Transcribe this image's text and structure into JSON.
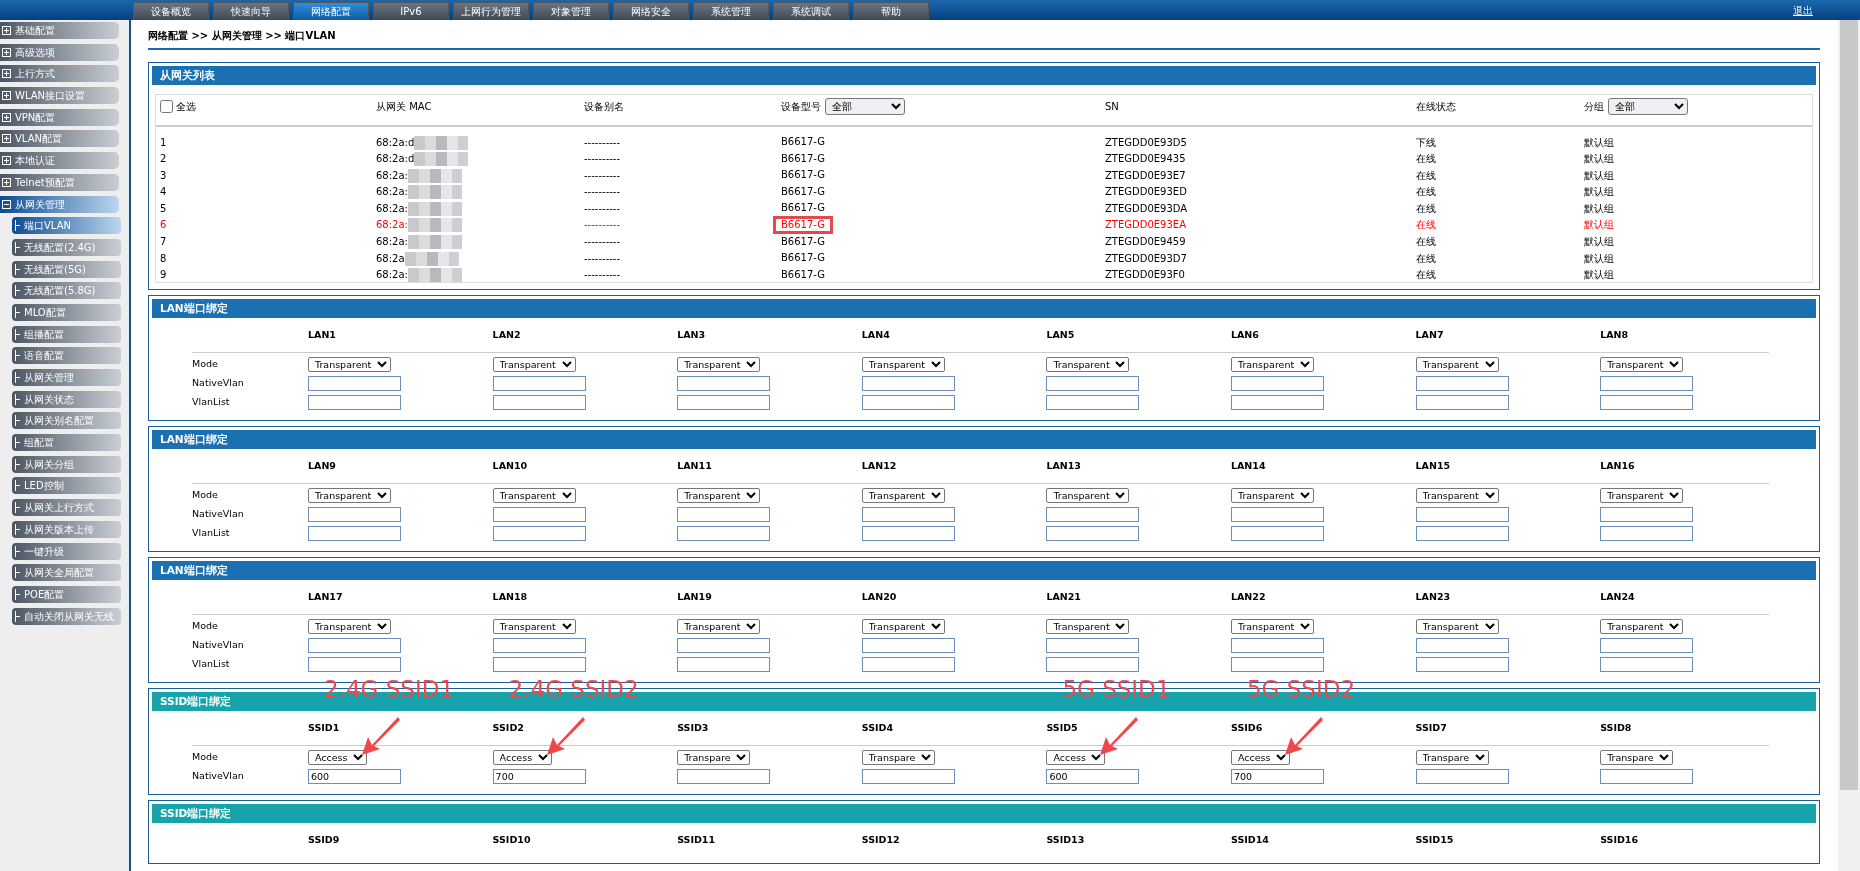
{
  "top_nav": {
    "tabs": [
      {
        "label": "设备概览",
        "selected": false
      },
      {
        "label": "快速向导",
        "selected": false
      },
      {
        "label": "网络配置",
        "selected": true
      },
      {
        "label": "IPv6",
        "selected": false
      },
      {
        "label": "上网行为管理",
        "selected": false
      },
      {
        "label": "对象管理",
        "selected": false
      },
      {
        "label": "网络安全",
        "selected": false
      },
      {
        "label": "系统管理",
        "selected": false
      },
      {
        "label": "系统调试",
        "selected": false
      },
      {
        "label": "帮助",
        "selected": false
      }
    ],
    "logout": "退出"
  },
  "sidebar": {
    "items": [
      {
        "label": "基础配置",
        "expanded": false
      },
      {
        "label": "高级选项",
        "expanded": false
      },
      {
        "label": "上行方式",
        "expanded": false
      },
      {
        "label": "WLAN接口设置",
        "expanded": false
      },
      {
        "label": "VPN配置",
        "expanded": false
      },
      {
        "label": "VLAN配置",
        "expanded": false
      },
      {
        "label": "本地认证",
        "expanded": false
      },
      {
        "label": "Telnet预配置",
        "expanded": false
      },
      {
        "label": "从网关管理",
        "expanded": true,
        "children": [
          {
            "label": "端口VLAN",
            "selected": true
          },
          {
            "label": "无线配置(2.4G)",
            "selected": false
          },
          {
            "label": "无线配置(5G)",
            "selected": false
          },
          {
            "label": "无线配置(5.8G)",
            "selected": false
          },
          {
            "label": "MLO配置",
            "selected": false
          },
          {
            "label": "组播配置",
            "selected": false
          },
          {
            "label": "语音配置",
            "selected": false
          },
          {
            "label": "从网关管理",
            "selected": false
          },
          {
            "label": "从网关状态",
            "selected": false
          },
          {
            "label": "从网关别名配置",
            "selected": false
          },
          {
            "label": "组配置",
            "selected": false
          },
          {
            "label": "从网关分组",
            "selected": false
          },
          {
            "label": "LED控制",
            "selected": false
          },
          {
            "label": "从网关上行方式",
            "selected": false
          },
          {
            "label": "从网关版本上传",
            "selected": false
          },
          {
            "label": "一键升级",
            "selected": false
          },
          {
            "label": "从网关全局配置",
            "selected": false
          },
          {
            "label": "POE配置",
            "selected": false
          },
          {
            "label": "自动关闭从网关无线",
            "selected": false
          }
        ]
      }
    ]
  },
  "breadcrumb": "网络配置 >> 从网关管理 >> 端口VLAN",
  "gateway_list": {
    "title": "从网关列表",
    "select_all": {
      "label": "全选",
      "checked": false
    },
    "columns": [
      {
        "label": "从网关 MAC"
      },
      {
        "label": "设备别名"
      },
      {
        "label": "设备型号",
        "filter": "全部"
      },
      {
        "label": "SN"
      },
      {
        "label": "在线状态"
      },
      {
        "label": "分组",
        "filter": "全部"
      }
    ],
    "rows": [
      {
        "index": "1",
        "mac": "68:2a:d",
        "alias": "----------",
        "model": "B6617-G",
        "sn": "ZTEGDD0E93D5",
        "status": "下线",
        "group": "默认组",
        "highlighted": false,
        "outlined": false
      },
      {
        "index": "2",
        "mac": "68:2a:d",
        "alias": "----------",
        "model": "B6617-G",
        "sn": "ZTEGDD0E9435",
        "status": "在线",
        "group": "默认组",
        "highlighted": false,
        "outlined": false
      },
      {
        "index": "3",
        "mac": "68:2a:",
        "alias": "----------",
        "model": "B6617-G",
        "sn": "ZTEGDD0E93E7",
        "status": "在线",
        "group": "默认组",
        "highlighted": false,
        "outlined": false
      },
      {
        "index": "4",
        "mac": "68:2a:",
        "alias": "----------",
        "model": "B6617-G",
        "sn": "ZTEGDD0E93ED",
        "status": "在线",
        "group": "默认组",
        "highlighted": false,
        "outlined": false
      },
      {
        "index": "5",
        "mac": "68:2a:",
        "alias": "----------",
        "model": "B6617-G",
        "sn": "ZTEGDD0E93DA",
        "status": "在线",
        "group": "默认组",
        "highlighted": false,
        "outlined": false
      },
      {
        "index": "6",
        "mac": "68:2a:",
        "alias": "----------",
        "model": "B6617-G",
        "sn": "ZTEGDD0E93EA",
        "status": "在线",
        "group": "默认组",
        "highlighted": true,
        "outlined": true
      },
      {
        "index": "7",
        "mac": "68:2a:",
        "alias": "----------",
        "model": "B6617-G",
        "sn": "ZTEGDD0E9459",
        "status": "在线",
        "group": "默认组",
        "highlighted": false,
        "outlined": false
      },
      {
        "index": "8",
        "mac": "68:2a",
        "alias": "----------",
        "model": "B6617-G",
        "sn": "ZTEGDD0E93D7",
        "status": "在线",
        "group": "默认组",
        "highlighted": false,
        "outlined": false
      },
      {
        "index": "9",
        "mac": "68:2a:",
        "alias": "----------",
        "model": "B6617-G",
        "sn": "ZTEGDD0E93F0",
        "status": "在线",
        "group": "默认组",
        "highlighted": false,
        "outlined": false
      }
    ]
  },
  "port_sections": [
    {
      "title": "LAN端口绑定",
      "kind": "lan",
      "row_labels": [
        "Mode",
        "NativeVlan",
        "VlanList"
      ],
      "ports": [
        {
          "name": "LAN1",
          "mode": "Transparent"
        },
        {
          "name": "LAN2",
          "mode": "Transparent"
        },
        {
          "name": "LAN3",
          "mode": "Transparent"
        },
        {
          "name": "LAN4",
          "mode": "Transparent"
        },
        {
          "name": "LAN5",
          "mode": "Transparent"
        },
        {
          "name": "LAN6",
          "mode": "Transparent"
        },
        {
          "name": "LAN7",
          "mode": "Transparent"
        },
        {
          "name": "LAN8",
          "mode": "Transparent"
        }
      ]
    },
    {
      "title": "LAN端口绑定",
      "kind": "lan",
      "row_labels": [
        "Mode",
        "NativeVlan",
        "VlanList"
      ],
      "ports": [
        {
          "name": "LAN9",
          "mode": "Transparent"
        },
        {
          "name": "LAN10",
          "mode": "Transparent"
        },
        {
          "name": "LAN11",
          "mode": "Transparent"
        },
        {
          "name": "LAN12",
          "mode": "Transparent"
        },
        {
          "name": "LAN13",
          "mode": "Transparent"
        },
        {
          "name": "LAN14",
          "mode": "Transparent"
        },
        {
          "name": "LAN15",
          "mode": "Transparent"
        },
        {
          "name": "LAN16",
          "mode": "Transparent"
        }
      ]
    },
    {
      "title": "LAN端口绑定",
      "kind": "lan",
      "row_labels": [
        "Mode",
        "NativeVlan",
        "VlanList"
      ],
      "ports": [
        {
          "name": "LAN17",
          "mode": "Transparent"
        },
        {
          "name": "LAN18",
          "mode": "Transparent"
        },
        {
          "name": "LAN19",
          "mode": "Transparent"
        },
        {
          "name": "LAN20",
          "mode": "Transparent"
        },
        {
          "name": "LAN21",
          "mode": "Transparent"
        },
        {
          "name": "LAN22",
          "mode": "Transparent"
        },
        {
          "name": "LAN23",
          "mode": "Transparent"
        },
        {
          "name": "LAN24",
          "mode": "Transparent"
        }
      ]
    },
    {
      "title": "SSID端口绑定",
      "kind": "ssid",
      "row_labels": [
        "Mode",
        "NativeVlan"
      ],
      "ports": [
        {
          "name": "SSID1",
          "mode": "Access",
          "native_vlan": "600",
          "annotation": "2.4G SSID1"
        },
        {
          "name": "SSID2",
          "mode": "Access",
          "native_vlan": "700",
          "annotation": "2.4G SSID2"
        },
        {
          "name": "SSID3",
          "mode": "Transpare"
        },
        {
          "name": "SSID4",
          "mode": "Transpare"
        },
        {
          "name": "SSID5",
          "mode": "Access",
          "native_vlan": "600",
          "annotation": "5G SSID1"
        },
        {
          "name": "SSID6",
          "mode": "Access",
          "native_vlan": "700",
          "annotation": "5G SSID2"
        },
        {
          "name": "SSID7",
          "mode": "Transpare"
        },
        {
          "name": "SSID8",
          "mode": "Transpare"
        }
      ]
    },
    {
      "title": "SSID端口绑定",
      "kind": "ssid",
      "ports": [
        {
          "name": "SSID9"
        },
        {
          "name": "SSID10"
        },
        {
          "name": "SSID11"
        },
        {
          "name": "SSID12"
        },
        {
          "name": "SSID13"
        },
        {
          "name": "SSID14"
        },
        {
          "name": "SSID15"
        },
        {
          "name": "SSID16"
        }
      ]
    }
  ]
}
